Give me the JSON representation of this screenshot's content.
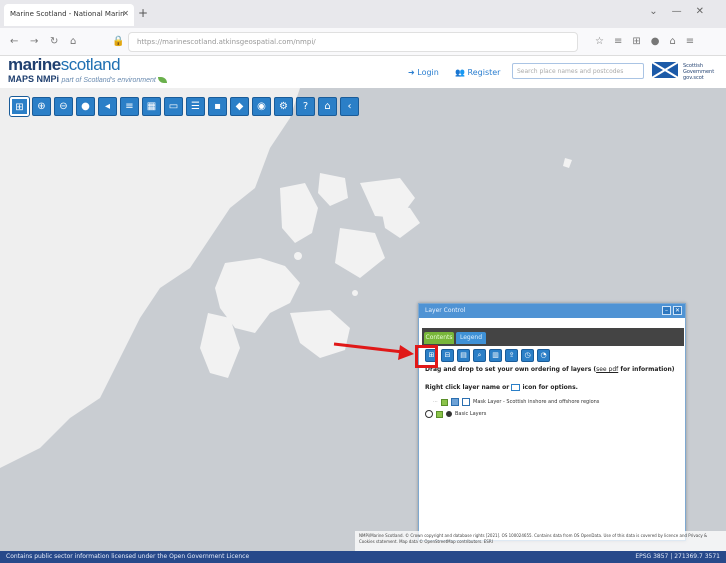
{
  "browser": {
    "tab_title": "Marine Scotland - National Marin",
    "url": "https://marinescotland.atkinsgeospatial.com/nmpi/",
    "url_host": "atkinsgeospatial.com"
  },
  "header": {
    "logo_primary": "marine",
    "logo_secondary": "scotland",
    "logo_sub": "MAPS NMPi",
    "logo_tagline": "part of Scotland's environment",
    "login_label": "Login",
    "register_label": "Register",
    "search_placeholder": "Search place names and postcodes",
    "gov_text": "Scottish Government gov.scot"
  },
  "map_toolbar": {
    "tools": [
      "add-data-icon",
      "zoom-in-icon",
      "zoom-out-icon",
      "globe-icon",
      "back-icon",
      "measure-icon",
      "grid-icon",
      "print-icon",
      "layers-icon",
      "bookmark-icon",
      "shape-icon",
      "info-icon",
      "settings-icon",
      "help-icon",
      "home-icon",
      "collapse-icon"
    ]
  },
  "layer_panel": {
    "title": "Layer Control",
    "tab_contents": "Contents",
    "tab_legend": "Legend",
    "instruction_1": "Drag and drop to set your own ordering of layers (",
    "instruction_link": "see pdf",
    "instruction_1b": " for information)",
    "instruction_2a": "Right click layer name or",
    "instruction_2b": "icon for options.",
    "layers": [
      {
        "name": "Mask Layer - Scottish inshore and offshore regions"
      },
      {
        "name": "Basic Layers"
      }
    ]
  },
  "attribution": "NMPi/Marine Scotland. © Crown copyright and database rights [2021]. OS 100024655. Contains data from OS OpenData. Use of this data is covered by licence and Privacy & Cookies statement. Map data © OpenStreetMap contributors. ESRI",
  "status_bar": {
    "left": "Contains public sector information licensed under the Open Government Licence",
    "right": "EPSG 3857 | 271369.7 3571"
  }
}
